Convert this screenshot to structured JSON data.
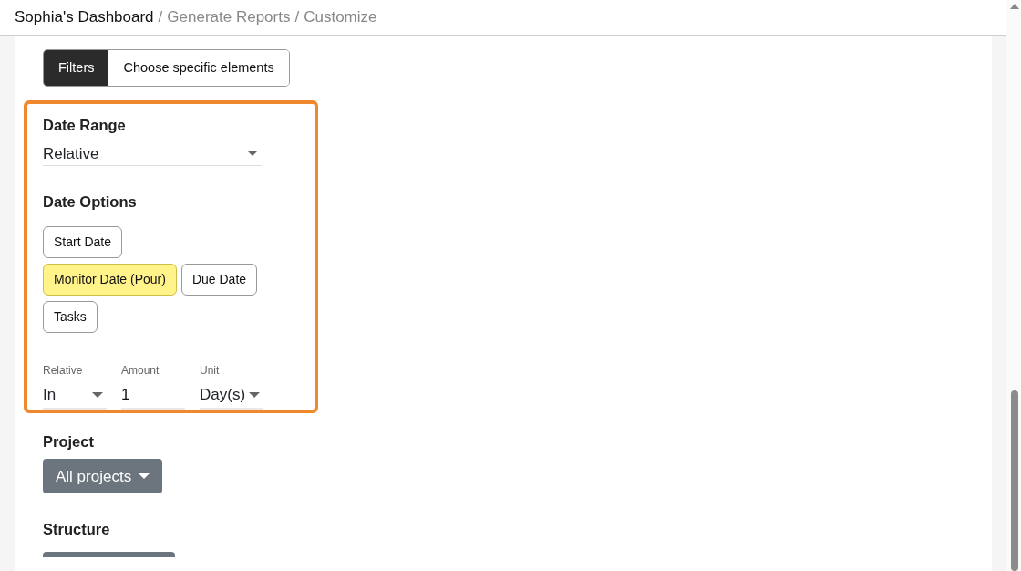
{
  "breadcrumb": [
    {
      "label": "Sophia's Dashboard",
      "kind": "home"
    },
    {
      "label": "/",
      "kind": "separator"
    },
    {
      "label": "Generate Reports",
      "kind": "link"
    },
    {
      "label": "/",
      "kind": "separator"
    },
    {
      "label": "Customize",
      "kind": "link"
    }
  ],
  "mode_toggle": [
    {
      "label": "Filters",
      "selected": true
    },
    {
      "label": "Choose specific elements",
      "selected": false
    }
  ],
  "date_range": {
    "label": "Date Range",
    "value": "Relative"
  },
  "date_options": {
    "label": "Date Options",
    "options": [
      {
        "label": "Start Date",
        "selected": false
      },
      {
        "label": "Monitor Date (Pour)",
        "selected": true
      },
      {
        "label": "Due Date",
        "selected": false
      },
      {
        "label": "Tasks",
        "selected": false
      }
    ]
  },
  "relative_fields": [
    {
      "kind": "select",
      "label": "Relative",
      "value": "In"
    },
    {
      "kind": "input",
      "label": "Amount",
      "value": "1"
    },
    {
      "kind": "select",
      "label": "Unit",
      "value": "Day(s)"
    }
  ],
  "project": {
    "label": "Project",
    "button": "All projects"
  },
  "structure": {
    "label": "Structure"
  }
}
